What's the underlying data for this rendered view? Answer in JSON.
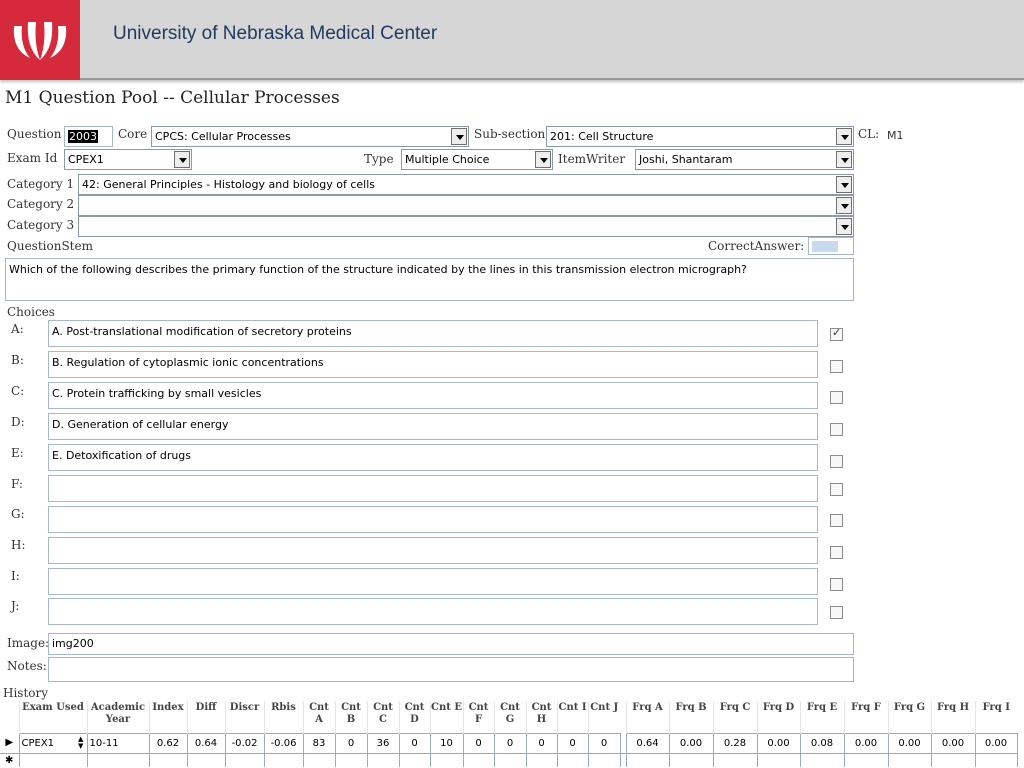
{
  "header": {
    "org_name": "University of Nebraska Medical Center",
    "logo_color": "#d42a3b"
  },
  "form": {
    "title": "M1 Question Pool -- Cellular Processes",
    "labels": {
      "question": "Question",
      "core": "Core",
      "subsection": "Sub-section",
      "cl": "CL:",
      "exam_id": "Exam Id",
      "type": "Type",
      "item_writer": "ItemWriter",
      "category1": "Category 1",
      "category2": "Category 2",
      "category3": "Category 3",
      "question_stem": "QuestionStem",
      "correct_answer": "CorrectAnswer:",
      "choices": "Choices",
      "image": "Image:",
      "notes": "Notes:",
      "history": "History"
    },
    "question_id": "2003",
    "core": "CPCS: Cellular Processes",
    "subsection": "201: Cell Structure",
    "cl_value": "M1",
    "exam_id": "CPEX1",
    "type": "Multiple Choice",
    "item_writer": "Joshi, Shantaram",
    "category1": "42: General Principles - Histology and biology of cells",
    "category2": "",
    "category3": "",
    "question_stem": "Which of the following describes the primary function of the structure indicated by the lines in this transmission electron micrograph?",
    "choices": [
      {
        "letter": "A:",
        "text": "A.  Post-translational modification of secretory proteins",
        "correct": true
      },
      {
        "letter": "B:",
        "text": "B.  Regulation of cytoplasmic ionic concentrations",
        "correct": false
      },
      {
        "letter": "C:",
        "text": "C.  Protein trafficking by small vesicles",
        "correct": false
      },
      {
        "letter": "D:",
        "text": "D.  Generation of cellular energy",
        "correct": false
      },
      {
        "letter": "E:",
        "text": "E.  Detoxification of drugs",
        "correct": false
      },
      {
        "letter": "F:",
        "text": "",
        "correct": false
      },
      {
        "letter": "G:",
        "text": "",
        "correct": false
      },
      {
        "letter": "H:",
        "text": "",
        "correct": false
      },
      {
        "letter": "I:",
        "text": "",
        "correct": false
      },
      {
        "letter": "J:",
        "text": "",
        "correct": false
      }
    ],
    "image": "img200",
    "notes": ""
  },
  "history": {
    "headers": [
      "Exam Used",
      "Academic Year",
      "Index",
      "Diff",
      "Discr",
      "Rbis",
      "Cnt A",
      "Cnt B",
      "Cnt C",
      "Cnt D",
      "Cnt E",
      "Cnt F",
      "Cnt G",
      "Cnt H",
      "Cnt I",
      "Cnt J",
      "Frq A",
      "Frq B",
      "Frq C",
      "Frq D",
      "Frq E",
      "Frq F",
      "Frq G",
      "Frq H",
      "Frq I"
    ],
    "rows": [
      [
        "CPEX1",
        "10-11",
        "0.62",
        "0.64",
        "-0.02",
        "-0.06",
        "83",
        "0",
        "36",
        "0",
        "10",
        "0",
        "0",
        "0",
        "0",
        "0",
        "0.64",
        "0.00",
        "0.28",
        "0.00",
        "0.08",
        "0.00",
        "0.00",
        "0.00",
        "0.00"
      ]
    ],
    "new_row_marker": "✱",
    "current_row_marker": "▶"
  }
}
